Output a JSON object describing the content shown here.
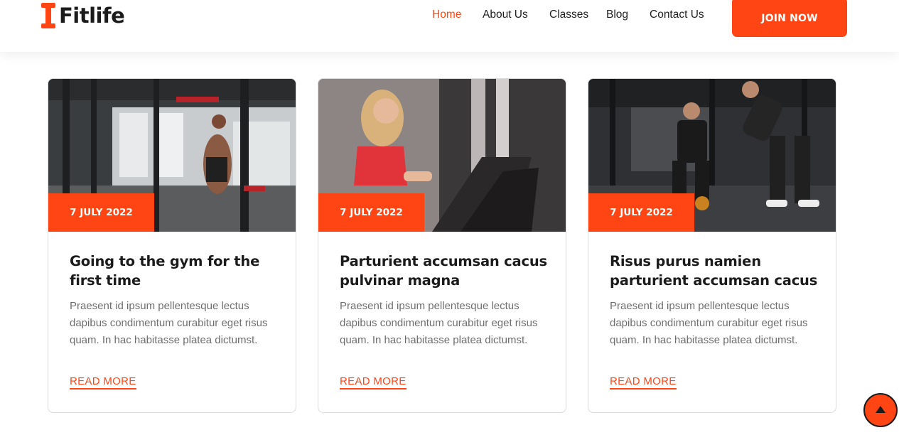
{
  "brand": {
    "name": "Fitlife",
    "accent_color": "#ff4514",
    "logo_icon": "dumbbell-icon"
  },
  "nav": {
    "items": [
      {
        "label": "Home",
        "active": true
      },
      {
        "label": "About Us",
        "active": false
      },
      {
        "label": "Classes",
        "active": false
      },
      {
        "label": "Blog",
        "active": false
      },
      {
        "label": "Contact Us",
        "active": false
      }
    ],
    "cta_label": "JOIN NOW"
  },
  "posts": [
    {
      "date": "7 JULY 2022",
      "title": "Going to the gym for the first time",
      "excerpt": "Praesent id ipsum pellentesque lectus dapibus condimentum curabitur eget risus quam. In hac habitasse platea dictumst.",
      "link_label": "READ MORE",
      "image": "man doing pull-ups in gym"
    },
    {
      "date": "7 JULY 2022",
      "title": "Parturient accumsan cacus pulvinar magna",
      "excerpt": "Praesent id ipsum pellentesque lectus dapibus condimentum curabitur eget risus quam. In hac habitasse platea dictumst.",
      "link_label": "READ MORE",
      "image": "woman running on treadmill"
    },
    {
      "date": "7 JULY 2022",
      "title": "Risus purus namien parturient accumsan cacus",
      "excerpt": "Praesent id ipsum pellentesque lectus dapibus condimentum curabitur eget risus quam. In hac habitasse platea dictumst.",
      "link_label": "READ MORE",
      "image": "man and woman training with kettlebells"
    }
  ],
  "scroll_top": {
    "icon": "arrow-up-icon"
  }
}
